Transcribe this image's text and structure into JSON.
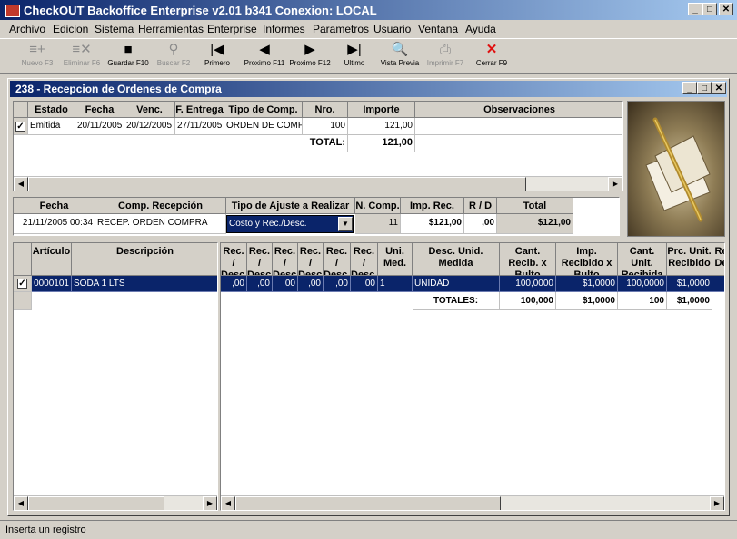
{
  "app": {
    "title": "CheckOUT Backoffice Enterprise v2.01 b341 Conexion: LOCAL",
    "controls": {
      "minimize": "_",
      "maximize": "□",
      "close": "✕"
    }
  },
  "menu": [
    "Archivo",
    "Edicion",
    "Sistema",
    "Herramientas",
    "Enterprise",
    "Informes",
    "Parametros",
    "Usuario",
    "Ventana",
    "Ayuda"
  ],
  "toolbar": [
    {
      "label": "Nuevo F3",
      "icon": "≡+",
      "enabled": false
    },
    {
      "label": "Eliminar F6",
      "icon": "≡✕",
      "enabled": false
    },
    {
      "label": "Guardar F10",
      "icon": "■",
      "enabled": true
    },
    {
      "label": "Buscar F2",
      "icon": "⚲",
      "enabled": false
    },
    {
      "label": "Primero",
      "icon": "|◀",
      "enabled": true
    },
    {
      "label": "Proximo F11",
      "icon": "◀",
      "enabled": true
    },
    {
      "label": "Proximo F12",
      "icon": "▶",
      "enabled": true
    },
    {
      "label": "Ultimo",
      "icon": "▶|",
      "enabled": true
    },
    {
      "label": "Vista Previa",
      "icon": "🔍",
      "enabled": true
    },
    {
      "label": "Imprimir F7",
      "icon": "⎙",
      "enabled": false
    },
    {
      "label": "Cerrar F9",
      "icon": "✕",
      "enabled": true
    }
  ],
  "window": {
    "title": "238 - Recepcion de Ordenes de Compra"
  },
  "orders": {
    "headers": [
      "Estado",
      "Fecha",
      "Venc.",
      "F. Entrega",
      "Tipo de Comp.",
      "Nro.",
      "Importe",
      "Observaciones"
    ],
    "row": {
      "estado": "Emitida",
      "fecha": "20/11/2005",
      "venc": "20/12/2005",
      "entrega": "27/11/2005",
      "tipo": "ORDEN DE COMPRA",
      "nro": "100",
      "importe": "121,00",
      "obs": ""
    },
    "total_label": "TOTAL:",
    "total_value": "121,00"
  },
  "reception": {
    "headers": [
      "Fecha",
      "Comp. Recepción",
      "Tipo de Ajuste a Realizar",
      "N. Comp.",
      "Imp. Rec.",
      "R / D",
      "Total"
    ],
    "row": {
      "fecha": "21/11/2005 00:34",
      "comp": "RECEP. ORDEN COMPRA",
      "tipo": "Costo y Rec./Desc.",
      "ncomp": "11",
      "imp": "$121,00",
      "rd": ",00",
      "total": "$121,00"
    }
  },
  "items_left": {
    "headers": [
      "Artículo",
      "Descripción"
    ],
    "row": {
      "articulo": "0000101",
      "descripcion": "SODA 1 LTS"
    }
  },
  "items_right": {
    "headers": [
      "Rec. / Desc.",
      "Rec. / Desc.",
      "Rec. / Desc.",
      "Rec. / Desc.",
      "Rec. / Desc.",
      "Rec. / Desc.",
      "Uni. Med.",
      "Desc. Unid. Medida",
      "Cant. Recib. x Bulto",
      "Imp. Recibido x Bulto",
      "Cant. Unit. Recibida",
      "Prc. Unit. Recibido",
      "Re De"
    ],
    "row": [
      ",00",
      ",00",
      ",00",
      ",00",
      ",00",
      ",00",
      "1",
      "UNIDAD",
      "100,0000",
      "$1,0000",
      "100,0000",
      "$1,0000",
      ""
    ],
    "totals": {
      "label": "TOTALES:",
      "cant_bulto": "100,000",
      "imp_bulto": "$1,0000",
      "cant_unit": "100",
      "prc_unit": "$1,0000"
    }
  },
  "status": "Inserta un registro"
}
